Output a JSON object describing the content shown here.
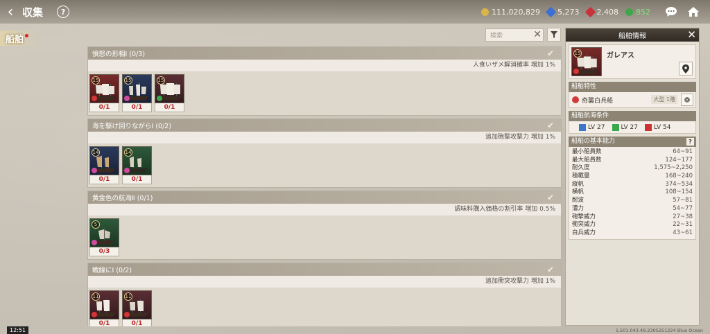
{
  "header": {
    "title": "収集",
    "currencies": [
      {
        "name": "gold",
        "value": "111,020,829"
      },
      {
        "name": "blue-gem",
        "value": "5,273"
      },
      {
        "name": "red-gem",
        "value": "2,408"
      },
      {
        "name": "green-points",
        "value": "852"
      }
    ]
  },
  "side_tab": {
    "label": "船舶"
  },
  "search": {
    "placeholder": "検索"
  },
  "groups": [
    {
      "title": "憤怒の形相Ⅰ (0/3)",
      "effect": "人食いザメ解消確率 増加 1%",
      "ships": [
        {
          "level": "15",
          "count": "0/1"
        },
        {
          "level": "15",
          "count": "0/1"
        },
        {
          "level": "15",
          "count": "0/1"
        }
      ]
    },
    {
      "title": "海を駆け回りながらⅠ (0/2)",
      "effect": "追加砲撃攻撃力 増加 1%",
      "ships": [
        {
          "level": "14",
          "count": "0/1"
        },
        {
          "level": "14",
          "count": "0/1"
        }
      ]
    },
    {
      "title": "黄金色の航海Ⅱ (0/1)",
      "effect": "調味料購入価格の割引率 増加 0.5%",
      "ships": [
        {
          "level": "5",
          "count": "0/3"
        }
      ]
    },
    {
      "title": "戦線にⅠ (0/2)",
      "effect": "追加衝突攻撃力 増加 1%",
      "ships": [
        {
          "level": "11",
          "count": "0/1"
        },
        {
          "level": "11",
          "count": "0/1"
        }
      ]
    }
  ],
  "panel": {
    "title": "船舶情報",
    "ship_level": "15",
    "ship_name": "ガレアス",
    "trait_header": "船舶特性",
    "trait_name": "奇襲白兵船",
    "trait_size": "大型 1階",
    "cond_header": "船舶航海条件",
    "conditions": [
      "LV 27",
      "LV 27",
      "LV 54"
    ],
    "stats_header": "船舶の基本能力",
    "help": "?",
    "stats": [
      {
        "label": "最小船員数",
        "value": "64~91"
      },
      {
        "label": "最大船員数",
        "value": "124~177"
      },
      {
        "label": "耐久度",
        "value": "1,575~2,250"
      },
      {
        "label": "積載量",
        "value": "168~240"
      },
      {
        "label": "縦帆",
        "value": "374~534"
      },
      {
        "label": "横帆",
        "value": "108~154"
      },
      {
        "label": "耐波",
        "value": "57~81"
      },
      {
        "label": "漕力",
        "value": "54~77"
      },
      {
        "label": "砲撃威力",
        "value": "27~38"
      },
      {
        "label": "衝突威力",
        "value": "22~31"
      },
      {
        "label": "白兵威力",
        "value": "43~61"
      }
    ]
  },
  "footer": {
    "time": "12:51",
    "build": "1.501.043.49.2305251224 Blue Ocean"
  }
}
